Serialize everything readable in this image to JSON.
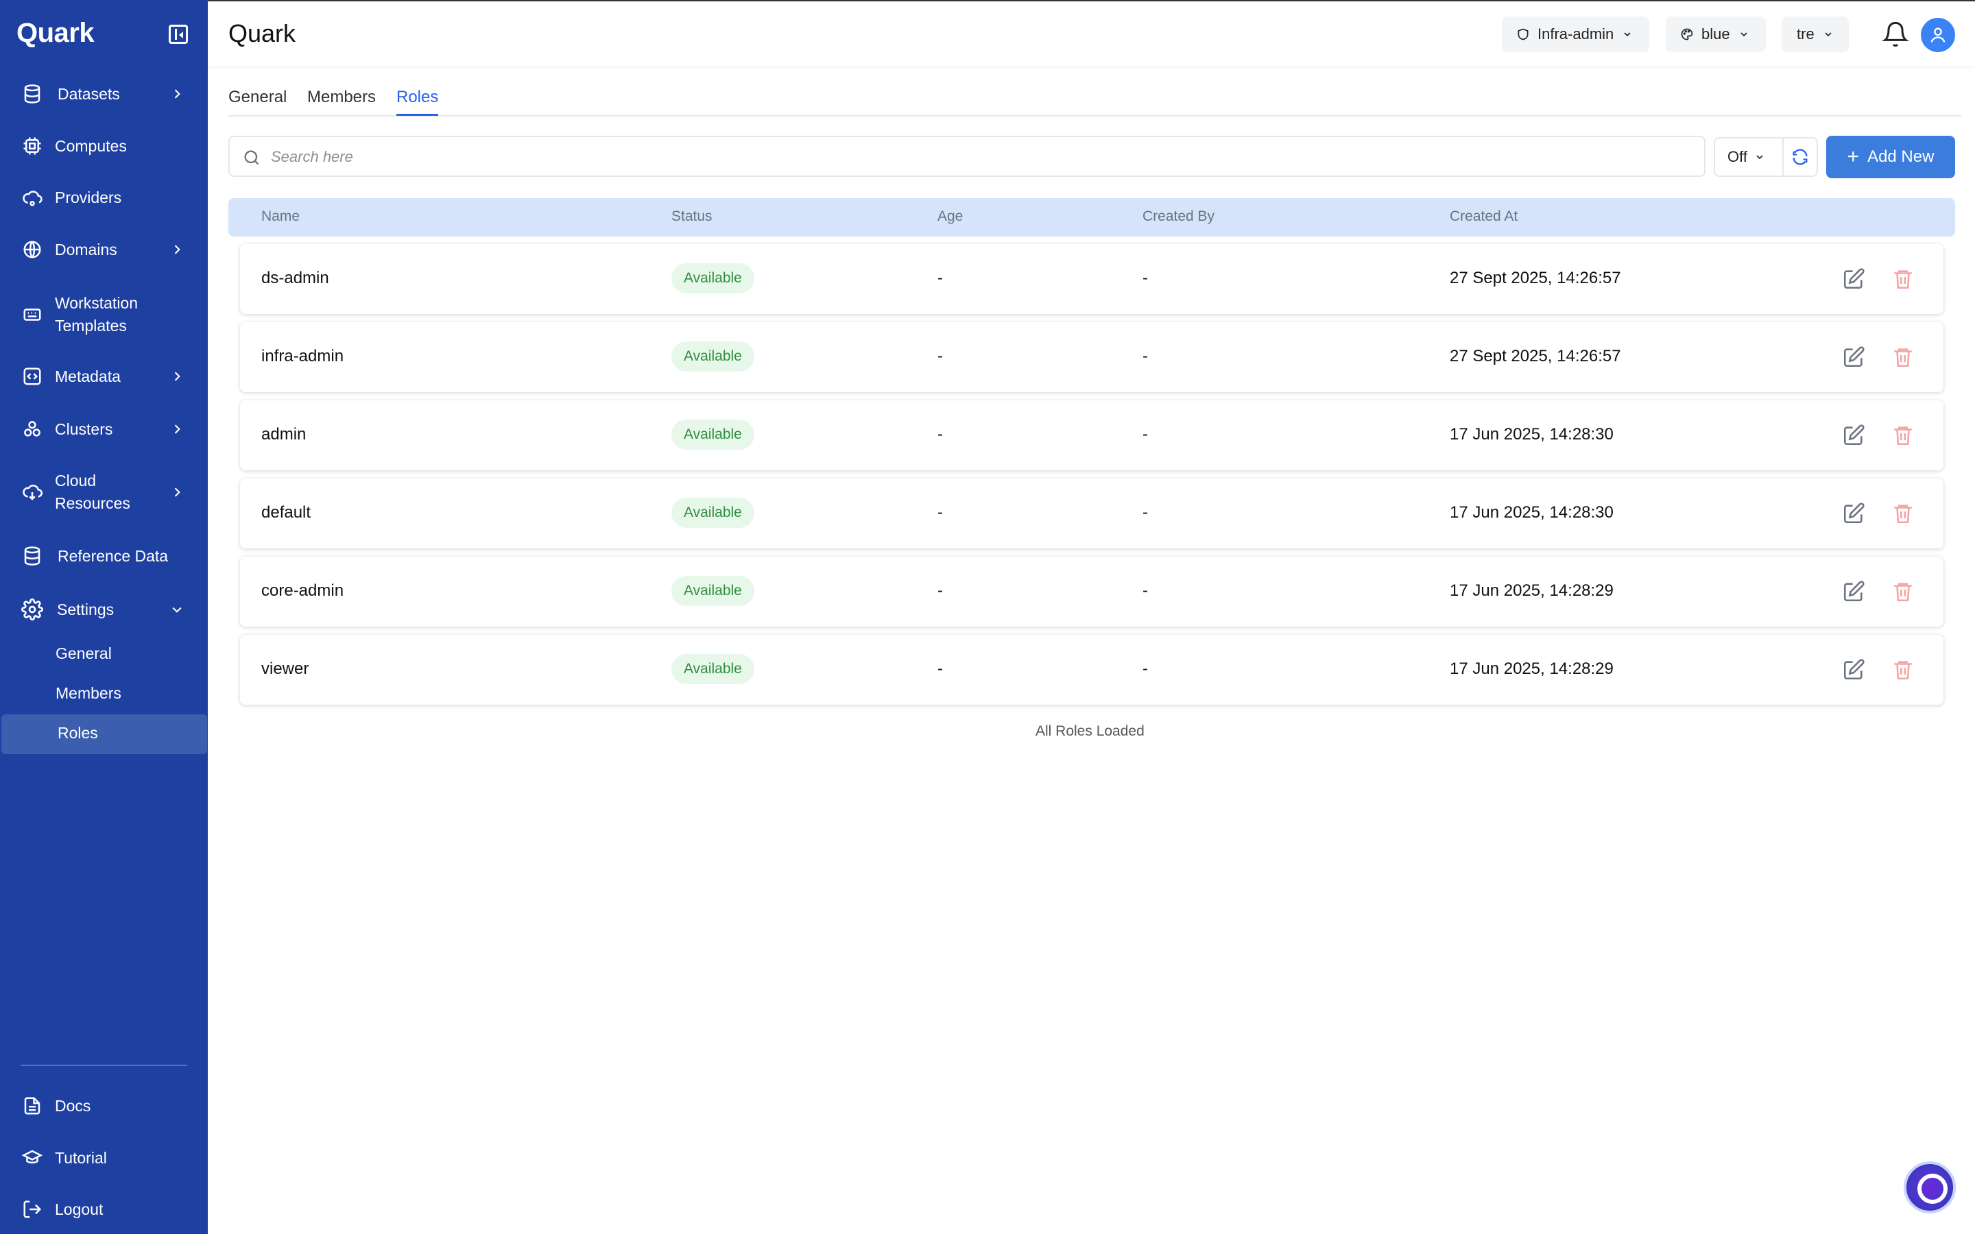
{
  "app": {
    "brand": "Quark",
    "page_title": "Quark"
  },
  "sidebar": {
    "items": [
      {
        "label": "Datasets",
        "icon": "database-icon",
        "has_chevron": true
      },
      {
        "label": "Computes",
        "icon": "cpu-icon",
        "has_chevron": false
      },
      {
        "label": "Providers",
        "icon": "cloud-link-icon",
        "has_chevron": false
      },
      {
        "label": "Domains",
        "icon": "globe-icon",
        "has_chevron": true
      },
      {
        "label": "Workstation Templates",
        "icon": "keyboard-icon",
        "has_chevron": false
      },
      {
        "label": "Metadata",
        "icon": "code-brackets-icon",
        "has_chevron": true
      },
      {
        "label": "Clusters",
        "icon": "cluster-icon",
        "has_chevron": true
      },
      {
        "label": "Cloud Resources",
        "icon": "cloud-download-icon",
        "has_chevron": true
      },
      {
        "label": "Reference Data",
        "icon": "database-icon",
        "has_chevron": false
      },
      {
        "label": "Settings",
        "icon": "gear-icon",
        "has_chevron": true,
        "expanded": true
      }
    ],
    "settings_sub": [
      {
        "label": "General"
      },
      {
        "label": "Members"
      },
      {
        "label": "Roles",
        "active": true
      }
    ],
    "bottom": [
      {
        "label": "Docs",
        "icon": "document-icon"
      },
      {
        "label": "Tutorial",
        "icon": "graduation-cap-icon"
      },
      {
        "label": "Logout",
        "icon": "logout-icon"
      }
    ]
  },
  "header": {
    "role_select": "Infra-admin",
    "theme_select": "blue",
    "lang_select": "tre"
  },
  "tabs": [
    {
      "label": "General"
    },
    {
      "label": "Members"
    },
    {
      "label": "Roles",
      "active": true
    }
  ],
  "toolbar": {
    "search_placeholder": "Search here",
    "filter_value": "Off",
    "add_label": "Add New"
  },
  "table": {
    "columns": [
      "Name",
      "Status",
      "Age",
      "Created By",
      "Created At"
    ],
    "rows": [
      {
        "name": "ds-admin",
        "status": "Available",
        "age": "-",
        "created_by": "-",
        "created_at": "27 Sept 2025, 14:26:57"
      },
      {
        "name": "infra-admin",
        "status": "Available",
        "age": "-",
        "created_by": "-",
        "created_at": "27 Sept 2025, 14:26:57"
      },
      {
        "name": "admin",
        "status": "Available",
        "age": "-",
        "created_by": "-",
        "created_at": "17 Jun 2025, 14:28:30"
      },
      {
        "name": "default",
        "status": "Available",
        "age": "-",
        "created_by": "-",
        "created_at": "17 Jun 2025, 14:28:30"
      },
      {
        "name": "core-admin",
        "status": "Available",
        "age": "-",
        "created_by": "-",
        "created_at": "17 Jun 2025, 14:28:29"
      },
      {
        "name": "viewer",
        "status": "Available",
        "age": "-",
        "created_by": "-",
        "created_at": "17 Jun 2025, 14:28:29"
      }
    ],
    "footer": "All Roles Loaded"
  },
  "colors": {
    "sidebar_bg": "#1e40a0",
    "accent": "#2563eb",
    "primary_button": "#3b7ddd",
    "badge_bg": "#e7f8ea",
    "badge_text": "#2f8f3e",
    "delete_icon": "#f4a3a3"
  }
}
